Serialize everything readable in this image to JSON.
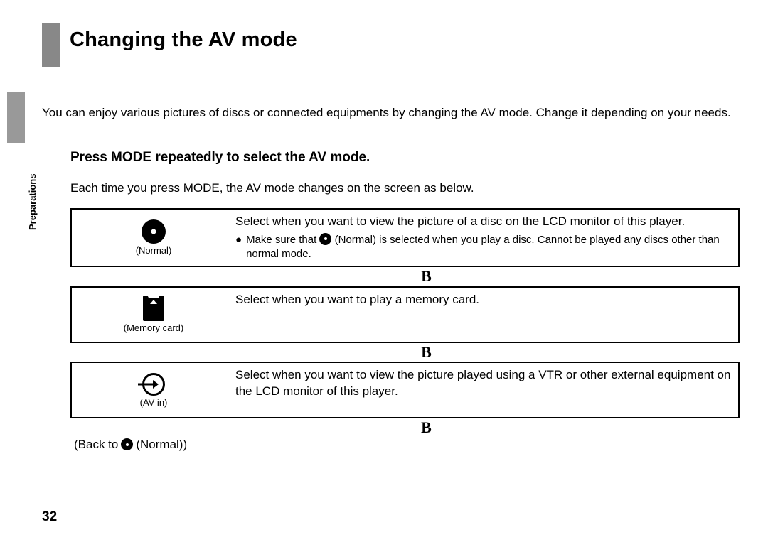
{
  "page": {
    "number": "32",
    "sidebar_label": "Preparations",
    "heading": "Changing the AV mode",
    "intro": "You can enjoy various pictures of discs or connected equipments by changing the AV mode. Change it depending on your needs.",
    "sub_heading": "Press MODE repeatedly to select the AV mode.",
    "sub_intro": "Each time you press MODE, the AV mode changes on the screen as below."
  },
  "modes": [
    {
      "icon": "disc",
      "caption": "(Normal)",
      "body": "Select when you want to view the picture of a disc on the LCD monitor of this player.",
      "note_prefix": "Make sure that ",
      "note_mid": " (Normal) is selected when you play a disc. Cannot be played any discs other than normal mode."
    },
    {
      "icon": "card",
      "caption": "(Memory card)",
      "body": "Select when you want to play a memory card."
    },
    {
      "icon": "avin",
      "caption": "(AV in)",
      "body": "Select when you want to view the picture played using a VTR or other external equipment on the LCD monitor of this player."
    }
  ],
  "arrows": {
    "glyph": "B"
  },
  "backto": {
    "prefix": "(Back to ",
    "label": " (Normal))"
  }
}
